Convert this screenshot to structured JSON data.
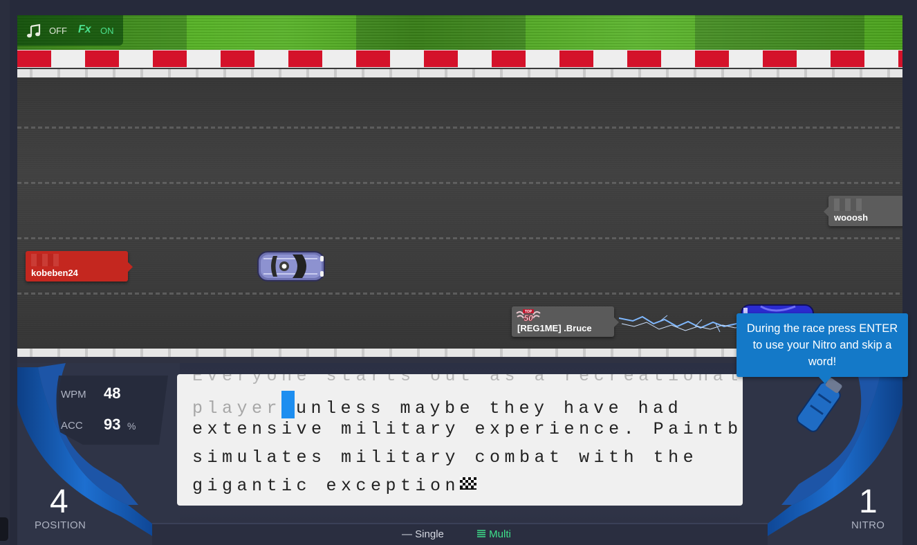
{
  "audio": {
    "music_state": "OFF",
    "fx_label": "Fx",
    "fx_state": "ON"
  },
  "racers": [
    {
      "name": "kobeben24",
      "tag_color": "#c4271f"
    },
    {
      "name": "[REG1ME] .Bruce",
      "badge": "TOP 50",
      "tag_color": "#5a5a5a"
    },
    {
      "name": "wooosh",
      "tag_color": "#5c5c5c"
    }
  ],
  "tooltip": {
    "text": "During the race press ENTER to use your Nitro and skip a word!"
  },
  "stats": {
    "wpm_label": "WPM",
    "wpm_value": "48",
    "acc_label": "ACC",
    "acc_value": "93",
    "acc_unit": "%"
  },
  "position": {
    "value": "4",
    "label": "POSITION"
  },
  "nitro": {
    "value": "1",
    "label": "NITRO"
  },
  "typing": {
    "line0": "Everyone starts out as a recreational",
    "line1_typed": "player",
    "line1_rest": "unless maybe they have had",
    "line2": "extensive military experience. Paintball",
    "line3": "simulates military combat with the",
    "line4": "gigantic exception"
  },
  "mode": {
    "single_label": "Single",
    "multi_label": "Multi",
    "active": "Multi"
  },
  "colors": {
    "accent_green": "#3ee08b",
    "tooltip_blue": "#1479c8",
    "cursor_blue": "#1d8ef0",
    "dashboard_blue": "#1565c0"
  }
}
